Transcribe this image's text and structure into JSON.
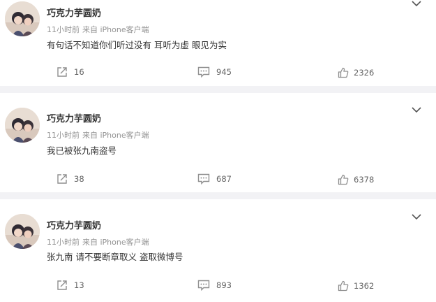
{
  "colors": {
    "separator": "#f2f2f5",
    "username": "#333333",
    "meta": "#939393",
    "count": "#636363",
    "icon": "#8f8f8f"
  },
  "posts": [
    {
      "username": "巧克力芋圆奶",
      "time": "11小时前",
      "source": "来自 iPhone客户端",
      "text": "有句话不知道你们听过没有 耳听为虚 眼见为实",
      "reposts": "16",
      "comments": "945",
      "likes": "2326"
    },
    {
      "username": "巧克力芋圆奶",
      "time": "11小时前",
      "source": "来自 iPhone客户端",
      "text": "我已被张九南盗号",
      "reposts": "38",
      "comments": "687",
      "likes": "6378"
    },
    {
      "username": "巧克力芋圆奶",
      "time": "11小时前",
      "source": "来自 iPhone客户端",
      "text": "张九南 请不要断章取义 盗取微博号",
      "reposts": "13",
      "comments": "893",
      "likes": "1362"
    }
  ]
}
